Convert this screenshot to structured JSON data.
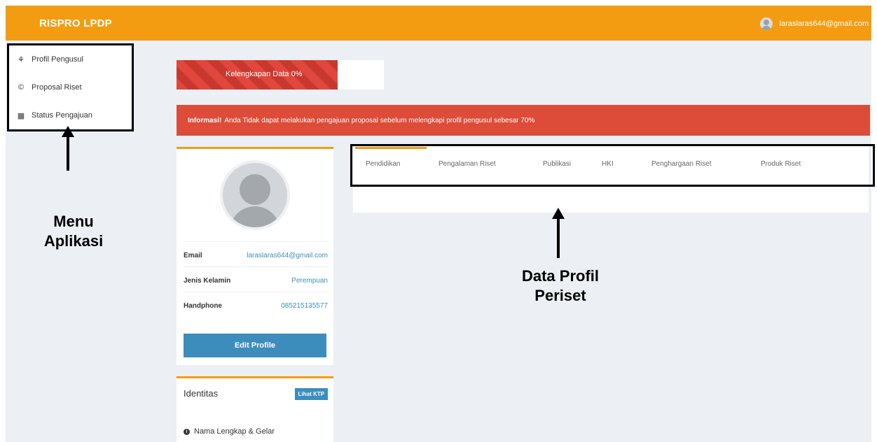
{
  "header": {
    "brand": "RISPRO LPDP",
    "user_email": "laraslaras644@gmail.com"
  },
  "sidebar": {
    "items": [
      {
        "label": "Profil Pengusul",
        "icon": "users-icon"
      },
      {
        "label": "Proposal Riset",
        "icon": "copyright-icon"
      },
      {
        "label": "Status Pengajuan",
        "icon": "grid-icon"
      }
    ]
  },
  "main": {
    "progress": {
      "label": "Kelengkapan Data 0%",
      "value": 0
    },
    "alert": {
      "bold": "Informasi!",
      "text": "Anda Tidak dapat melakukan pengajuan proposal sebelum melengkapi profil pengusul sebesar 70%"
    },
    "profile": {
      "email_label": "Email",
      "email_value": "laraslaras644@gmail.com",
      "gender_label": "Jenis Kelamin",
      "gender_value": "Perempuan",
      "phone_label": "Handphone",
      "phone_value": "085215135577",
      "edit_label": "Edit Profile"
    },
    "identity": {
      "title": "Identitas",
      "ktp_label": "Lihat KTP",
      "field_label": "Nama Lengkap & Gelar"
    },
    "tabs": [
      {
        "label": "Pendidikan"
      },
      {
        "label": "Pengalaman Riset"
      },
      {
        "label": "Publikasi"
      },
      {
        "label": "HKI"
      },
      {
        "label": "Penghargaan Riset"
      },
      {
        "label": "Produk Riset"
      }
    ]
  },
  "annotations": {
    "menu_line1": "Menu",
    "menu_line2": "Aplikasi",
    "data_line1": "Data Profil",
    "data_line2": "Periset"
  },
  "colors": {
    "brand": "#f39c12",
    "danger": "#dd4b39",
    "primary": "#3c8dbc"
  }
}
